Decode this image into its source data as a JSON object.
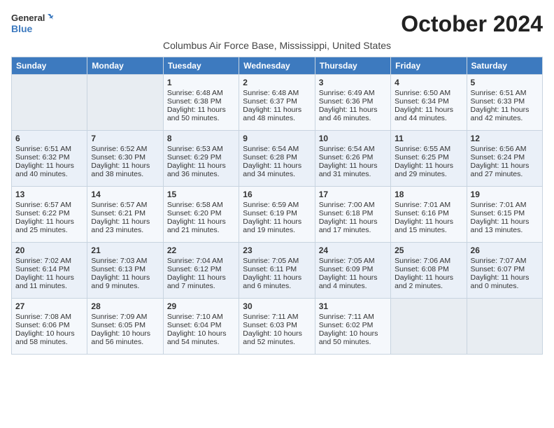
{
  "logo": {
    "line1": "General",
    "line2": "Blue"
  },
  "title": "October 2024",
  "subtitle": "Columbus Air Force Base, Mississippi, United States",
  "days_of_week": [
    "Sunday",
    "Monday",
    "Tuesday",
    "Wednesday",
    "Thursday",
    "Friday",
    "Saturday"
  ],
  "weeks": [
    [
      {
        "day": "",
        "content": ""
      },
      {
        "day": "",
        "content": ""
      },
      {
        "day": "1",
        "content": "Sunrise: 6:48 AM\nSunset: 6:38 PM\nDaylight: 11 hours and 50 minutes."
      },
      {
        "day": "2",
        "content": "Sunrise: 6:48 AM\nSunset: 6:37 PM\nDaylight: 11 hours and 48 minutes."
      },
      {
        "day": "3",
        "content": "Sunrise: 6:49 AM\nSunset: 6:36 PM\nDaylight: 11 hours and 46 minutes."
      },
      {
        "day": "4",
        "content": "Sunrise: 6:50 AM\nSunset: 6:34 PM\nDaylight: 11 hours and 44 minutes."
      },
      {
        "day": "5",
        "content": "Sunrise: 6:51 AM\nSunset: 6:33 PM\nDaylight: 11 hours and 42 minutes."
      }
    ],
    [
      {
        "day": "6",
        "content": "Sunrise: 6:51 AM\nSunset: 6:32 PM\nDaylight: 11 hours and 40 minutes."
      },
      {
        "day": "7",
        "content": "Sunrise: 6:52 AM\nSunset: 6:30 PM\nDaylight: 11 hours and 38 minutes."
      },
      {
        "day": "8",
        "content": "Sunrise: 6:53 AM\nSunset: 6:29 PM\nDaylight: 11 hours and 36 minutes."
      },
      {
        "day": "9",
        "content": "Sunrise: 6:54 AM\nSunset: 6:28 PM\nDaylight: 11 hours and 34 minutes."
      },
      {
        "day": "10",
        "content": "Sunrise: 6:54 AM\nSunset: 6:26 PM\nDaylight: 11 hours and 31 minutes."
      },
      {
        "day": "11",
        "content": "Sunrise: 6:55 AM\nSunset: 6:25 PM\nDaylight: 11 hours and 29 minutes."
      },
      {
        "day": "12",
        "content": "Sunrise: 6:56 AM\nSunset: 6:24 PM\nDaylight: 11 hours and 27 minutes."
      }
    ],
    [
      {
        "day": "13",
        "content": "Sunrise: 6:57 AM\nSunset: 6:22 PM\nDaylight: 11 hours and 25 minutes."
      },
      {
        "day": "14",
        "content": "Sunrise: 6:57 AM\nSunset: 6:21 PM\nDaylight: 11 hours and 23 minutes."
      },
      {
        "day": "15",
        "content": "Sunrise: 6:58 AM\nSunset: 6:20 PM\nDaylight: 11 hours and 21 minutes."
      },
      {
        "day": "16",
        "content": "Sunrise: 6:59 AM\nSunset: 6:19 PM\nDaylight: 11 hours and 19 minutes."
      },
      {
        "day": "17",
        "content": "Sunrise: 7:00 AM\nSunset: 6:18 PM\nDaylight: 11 hours and 17 minutes."
      },
      {
        "day": "18",
        "content": "Sunrise: 7:01 AM\nSunset: 6:16 PM\nDaylight: 11 hours and 15 minutes."
      },
      {
        "day": "19",
        "content": "Sunrise: 7:01 AM\nSunset: 6:15 PM\nDaylight: 11 hours and 13 minutes."
      }
    ],
    [
      {
        "day": "20",
        "content": "Sunrise: 7:02 AM\nSunset: 6:14 PM\nDaylight: 11 hours and 11 minutes."
      },
      {
        "day": "21",
        "content": "Sunrise: 7:03 AM\nSunset: 6:13 PM\nDaylight: 11 hours and 9 minutes."
      },
      {
        "day": "22",
        "content": "Sunrise: 7:04 AM\nSunset: 6:12 PM\nDaylight: 11 hours and 7 minutes."
      },
      {
        "day": "23",
        "content": "Sunrise: 7:05 AM\nSunset: 6:11 PM\nDaylight: 11 hours and 6 minutes."
      },
      {
        "day": "24",
        "content": "Sunrise: 7:05 AM\nSunset: 6:09 PM\nDaylight: 11 hours and 4 minutes."
      },
      {
        "day": "25",
        "content": "Sunrise: 7:06 AM\nSunset: 6:08 PM\nDaylight: 11 hours and 2 minutes."
      },
      {
        "day": "26",
        "content": "Sunrise: 7:07 AM\nSunset: 6:07 PM\nDaylight: 11 hours and 0 minutes."
      }
    ],
    [
      {
        "day": "27",
        "content": "Sunrise: 7:08 AM\nSunset: 6:06 PM\nDaylight: 10 hours and 58 minutes."
      },
      {
        "day": "28",
        "content": "Sunrise: 7:09 AM\nSunset: 6:05 PM\nDaylight: 10 hours and 56 minutes."
      },
      {
        "day": "29",
        "content": "Sunrise: 7:10 AM\nSunset: 6:04 PM\nDaylight: 10 hours and 54 minutes."
      },
      {
        "day": "30",
        "content": "Sunrise: 7:11 AM\nSunset: 6:03 PM\nDaylight: 10 hours and 52 minutes."
      },
      {
        "day": "31",
        "content": "Sunrise: 7:11 AM\nSunset: 6:02 PM\nDaylight: 10 hours and 50 minutes."
      },
      {
        "day": "",
        "content": ""
      },
      {
        "day": "",
        "content": ""
      }
    ]
  ]
}
